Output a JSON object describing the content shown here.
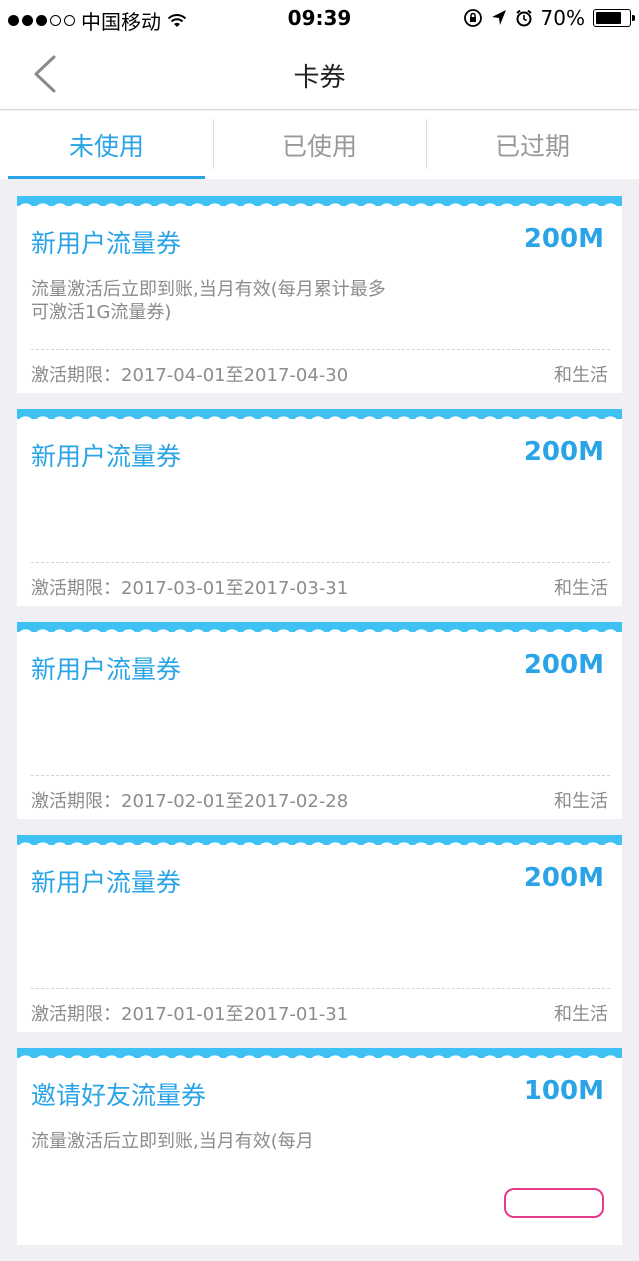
{
  "statusbar": {
    "carrier": "中国移动",
    "time": "09:39",
    "battery": "70%"
  },
  "nav": {
    "title": "卡券"
  },
  "tabs": [
    {
      "label": "未使用"
    },
    {
      "label": "已使用"
    },
    {
      "label": "已过期"
    }
  ],
  "colors": {
    "accent": "#2aa4e6",
    "wave": "#3fc1f3"
  },
  "coupons": [
    {
      "title": "新用户流量券",
      "amount": "200M",
      "desc": "流量激活后立即到账,当月有效(每月累计最多可激活1G流量券)",
      "period": "激活期限：2017-04-01至2017-04-30",
      "source": "和生活"
    },
    {
      "title": "新用户流量券",
      "amount": "200M",
      "desc": "",
      "period": "激活期限：2017-03-01至2017-03-31",
      "source": "和生活"
    },
    {
      "title": "新用户流量券",
      "amount": "200M",
      "desc": "",
      "period": "激活期限：2017-02-01至2017-02-28",
      "source": "和生活"
    },
    {
      "title": "新用户流量券",
      "amount": "200M",
      "desc": "",
      "period": "激活期限：2017-01-01至2017-01-31",
      "source": "和生活"
    },
    {
      "title": "邀请好友流量券",
      "amount": "100M",
      "desc": "流量激活后立即到账,当月有效(每月",
      "period": "",
      "source": ""
    }
  ]
}
